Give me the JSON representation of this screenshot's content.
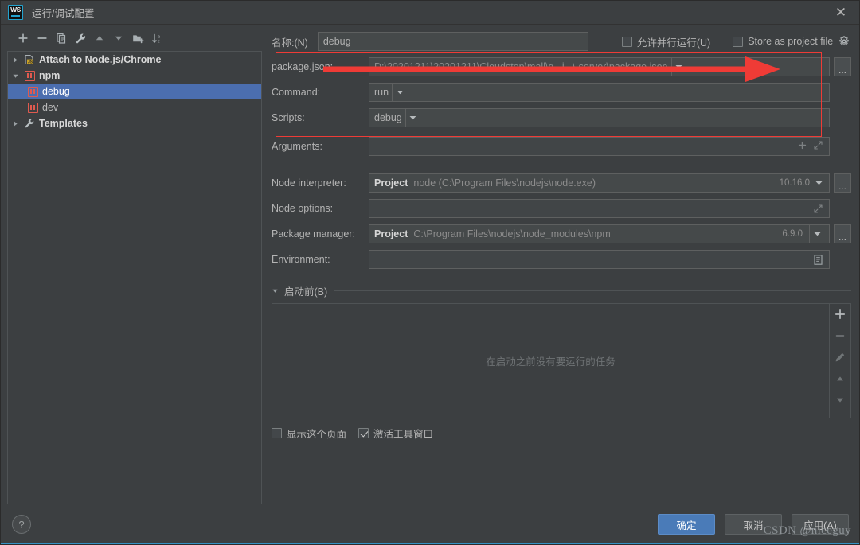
{
  "window": {
    "title": "运行/调试配置",
    "logo_text": "WS",
    "close_icon": "close-icon"
  },
  "toolbar": {
    "items": [
      {
        "name": "add-icon",
        "title": "+"
      },
      {
        "name": "remove-icon",
        "title": "−"
      },
      {
        "name": "copy-icon",
        "title": "Copy"
      },
      {
        "name": "wrench-icon",
        "title": "Edit Templates"
      },
      {
        "name": "move-up-icon",
        "title": "Move Up"
      },
      {
        "name": "move-down-icon",
        "title": "Move Down"
      },
      {
        "name": "folder-add-icon",
        "title": "New Folder"
      },
      {
        "name": "sort-alpha-icon",
        "title": "Sort"
      }
    ]
  },
  "tree": {
    "items": [
      {
        "label": "Attach to Node.js/Chrome",
        "icon": "js-file-icon",
        "twisty": "collapsed",
        "level": 1,
        "bold": true,
        "selected": false
      },
      {
        "label": "npm",
        "icon": "npm-icon",
        "twisty": "expanded",
        "level": 1,
        "bold": true,
        "selected": false
      },
      {
        "label": "debug",
        "icon": "npm-icon",
        "twisty": "none",
        "level": 2,
        "bold": false,
        "selected": true
      },
      {
        "label": "dev",
        "icon": "npm-icon",
        "twisty": "none",
        "level": 2,
        "bold": false,
        "selected": false
      },
      {
        "label": "Templates",
        "icon": "wrench-icon",
        "twisty": "collapsed",
        "level": 1,
        "bold": true,
        "selected": false
      }
    ]
  },
  "form": {
    "name_label": "名称:(N)",
    "name_value": "debug",
    "allow_parallel_label": "允许并行运行(U)",
    "allow_parallel_checked": false,
    "store_as_project_label": "Store as project file",
    "store_as_project_checked": false,
    "gear_icon": "gear-icon",
    "rows": [
      {
        "label": "package.json:",
        "value": "D:\\20201211\\20201211\\Cloudstep\\mall\\g...j...\\-server\\package.json",
        "type": "combo",
        "has_ellipsis": true,
        "dim": false
      },
      {
        "label": "Command:",
        "value": "run",
        "type": "combo",
        "has_ellipsis": false,
        "dim": false
      },
      {
        "label": "Scripts:",
        "value": "debug",
        "type": "combo",
        "has_ellipsis": false,
        "dim": false
      },
      {
        "label": "Arguments:",
        "value": "",
        "type": "args",
        "has_ellipsis": false,
        "dim": false
      }
    ],
    "node_interpreter_label": "Node interpreter:",
    "node_interpreter_tag": "Project",
    "node_interpreter_value": "node (C:\\Program Files\\nodejs\\node.exe)",
    "node_interpreter_version": "10.16.0",
    "node_options_label": "Node options:",
    "node_options_value": "",
    "package_manager_label": "Package manager:",
    "package_manager_tag": "Project",
    "package_manager_value": "C:\\Program Files\\nodejs\\node_modules\\npm",
    "package_manager_version": "6.9.0",
    "environment_label": "Environment:",
    "environment_value": ""
  },
  "before_launch": {
    "header": "启动前(B)",
    "empty_text": "在启动之前没有要运行的任务",
    "side_buttons": [
      {
        "name": "add-task-icon"
      },
      {
        "name": "remove-task-icon"
      },
      {
        "name": "edit-task-icon"
      },
      {
        "name": "move-task-up-icon"
      },
      {
        "name": "move-task-down-icon"
      }
    ],
    "show_page_label": "显示这个页面",
    "show_page_checked": false,
    "activate_tool_window_label": "激活工具窗口",
    "activate_tool_window_checked": true
  },
  "footer": {
    "help_label": "?",
    "ok_label": "确定",
    "cancel_label": "取消",
    "apply_label": "应用(A)",
    "watermark": "CSDN @niceguy"
  },
  "colors": {
    "background": "#3c3f41",
    "selection": "#4b6eaf",
    "accent": "#3592c4",
    "annotation_red": "#ef3b36",
    "npm_red": "#e05a4f",
    "primary_button": "#4a7bb8"
  }
}
